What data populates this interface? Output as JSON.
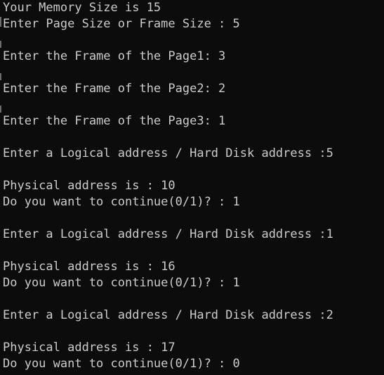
{
  "console": {
    "lines": [
      "Your Memory Size is 15",
      "Enter Page Size or Frame Size : 5",
      "",
      "Enter the Frame of the Page1: 3",
      "",
      "Enter the Frame of the Page2: 2",
      "",
      "Enter the Frame of the Page3: 1",
      "",
      "Enter a Logical address / Hard Disk address :5",
      "",
      "Physical address is : 10",
      "Do you want to continue(0/1)? : 1",
      "",
      "Enter a Logical address / Hard Disk address :1",
      "",
      "Physical address is : 16",
      "Do you want to continue(0/1)? : 1",
      "",
      "Enter a Logical address / Hard Disk address :2",
      "",
      "Physical address is : 17",
      "Do you want to continue(0/1)? : 0"
    ]
  },
  "colors": {
    "background": "#0c0c0c",
    "text": "#cccccc"
  }
}
